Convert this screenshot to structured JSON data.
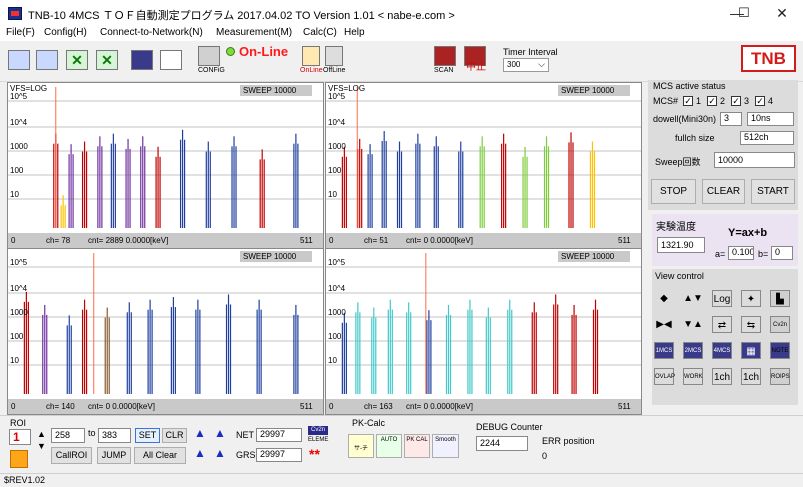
{
  "window": {
    "title": "TNB-10 4MCS ＴＯＦ自動測定プログラム 2017.04.02 TO Version 1.01 < nabe-e.com >",
    "minimize": "—",
    "maximize": "☐",
    "close": "✕"
  },
  "menu": [
    "File(F)",
    "Config(H)",
    "Connect-to-Network(N)",
    "Measurement(M)",
    "Calc(C)",
    "Help"
  ],
  "toolbar": {
    "config_label": "CONFiG",
    "online_status": "On-Line",
    "online_btn_label": "OnLine",
    "offline_btn_label": "OffLine",
    "scan_label": "SCAN",
    "stop_label": "中止",
    "timer_interval_label": "Timer Interval",
    "timer_interval_value": "300",
    "logo": "TNB"
  },
  "plots": [
    {
      "header": "VFS=LOG",
      "sweep": "SWEEP  10000",
      "ylabels": [
        "10^5",
        "10^4",
        "1000",
        "100",
        "10",
        "0"
      ],
      "footer_ch": "ch=  78",
      "footer_cnt": "cnt=   2889  0.0000[keV]",
      "footer_max": "511",
      "cursor": 78,
      "peaks": [
        {
          "ch": 78,
          "h": 0.72,
          "color": "#c00000"
        },
        {
          "ch": 90,
          "h": 0.25,
          "color": "#ffc000"
        },
        {
          "ch": 103,
          "h": 0.64,
          "color": "#7030a0"
        },
        {
          "ch": 125,
          "h": 0.66,
          "color": "#c00000"
        },
        {
          "ch": 150,
          "h": 0.7,
          "color": "#7030a0"
        },
        {
          "ch": 172,
          "h": 0.72,
          "color": "#1f3f9f"
        },
        {
          "ch": 196,
          "h": 0.68,
          "color": "#7030a0"
        },
        {
          "ch": 220,
          "h": 0.7,
          "color": "#7030a0"
        },
        {
          "ch": 245,
          "h": 0.62,
          "color": "#c00000"
        },
        {
          "ch": 285,
          "h": 0.75,
          "color": "#1f3f9f"
        },
        {
          "ch": 327,
          "h": 0.66,
          "color": "#1f3f9f"
        },
        {
          "ch": 369,
          "h": 0.7,
          "color": "#1f3f9f"
        },
        {
          "ch": 415,
          "h": 0.6,
          "color": "#c00000"
        },
        {
          "ch": 470,
          "h": 0.72,
          "color": "#1f3f9f"
        }
      ]
    },
    {
      "header": "VFS=LOG",
      "sweep": "SWEEP  10000",
      "ylabels": [
        "10^5",
        "10^4",
        "1000",
        "100",
        "10",
        "0"
      ],
      "footer_ch": "ch=  51",
      "footer_cnt": "cnt=    0  0.0000[keV]",
      "footer_max": "511",
      "cursor": 51,
      "peaks": [
        {
          "ch": 30,
          "h": 0.62,
          "color": "#c00000"
        },
        {
          "ch": 55,
          "h": 0.68,
          "color": "#c00000"
        },
        {
          "ch": 72,
          "h": 0.64,
          "color": "#1f3f9f"
        },
        {
          "ch": 95,
          "h": 0.74,
          "color": "#1f3f9f"
        },
        {
          "ch": 120,
          "h": 0.66,
          "color": "#1f3f9f"
        },
        {
          "ch": 150,
          "h": 0.72,
          "color": "#1f3f9f"
        },
        {
          "ch": 180,
          "h": 0.7,
          "color": "#1f3f9f"
        },
        {
          "ch": 220,
          "h": 0.66,
          "color": "#1f3f9f"
        },
        {
          "ch": 255,
          "h": 0.7,
          "color": "#7ccd3c"
        },
        {
          "ch": 290,
          "h": 0.72,
          "color": "#c00000"
        },
        {
          "ch": 325,
          "h": 0.62,
          "color": "#7ccd3c"
        },
        {
          "ch": 360,
          "h": 0.7,
          "color": "#7ccd3c"
        },
        {
          "ch": 400,
          "h": 0.73,
          "color": "#c00000"
        },
        {
          "ch": 435,
          "h": 0.66,
          "color": "#ffc000"
        }
      ]
    },
    {
      "header": "",
      "sweep": "SWEEP  10000",
      "ylabels": [
        "10^5",
        "10^4",
        "1000",
        "100",
        "10",
        "0"
      ],
      "footer_ch": "ch= 140",
      "footer_cnt": "cnt=    0  0.0000[keV]",
      "footer_max": "511",
      "cursor": 140,
      "peaks": [
        {
          "ch": 30,
          "h": 0.78,
          "color": "#c00000"
        },
        {
          "ch": 60,
          "h": 0.68,
          "color": "#7030a0"
        },
        {
          "ch": 100,
          "h": 0.6,
          "color": "#1f3f9f"
        },
        {
          "ch": 125,
          "h": 0.72,
          "color": "#c00000"
        },
        {
          "ch": 162,
          "h": 0.66,
          "color": "#8b5a2b"
        },
        {
          "ch": 198,
          "h": 0.7,
          "color": "#1f3f9f"
        },
        {
          "ch": 232,
          "h": 0.72,
          "color": "#1f3f9f"
        },
        {
          "ch": 270,
          "h": 0.74,
          "color": "#1f3f9f"
        },
        {
          "ch": 310,
          "h": 0.72,
          "color": "#1f3f9f"
        },
        {
          "ch": 360,
          "h": 0.76,
          "color": "#1f3f9f"
        },
        {
          "ch": 410,
          "h": 0.72,
          "color": "#1f3f9f"
        },
        {
          "ch": 470,
          "h": 0.68,
          "color": "#1f3f9f"
        }
      ]
    },
    {
      "header": "",
      "sweep": "SWEEP  10000",
      "ylabels": [
        "10^5",
        "10^4",
        "1000",
        "100",
        "10",
        "0"
      ],
      "footer_ch": "ch= 163",
      "footer_cnt": "cnt=    0  0.0000[keV]",
      "footer_max": "511",
      "cursor": 163,
      "peaks": [
        {
          "ch": 30,
          "h": 0.62,
          "color": "#1f3f9f"
        },
        {
          "ch": 52,
          "h": 0.7,
          "color": "#40c8c8"
        },
        {
          "ch": 78,
          "h": 0.66,
          "color": "#40c8c8"
        },
        {
          "ch": 105,
          "h": 0.72,
          "color": "#40c8c8"
        },
        {
          "ch": 135,
          "h": 0.7,
          "color": "#40c8c8"
        },
        {
          "ch": 168,
          "h": 0.64,
          "color": "#1f3f9f"
        },
        {
          "ch": 200,
          "h": 0.68,
          "color": "#40c8c8"
        },
        {
          "ch": 235,
          "h": 0.72,
          "color": "#40c8c8"
        },
        {
          "ch": 265,
          "h": 0.66,
          "color": "#40c8c8"
        },
        {
          "ch": 300,
          "h": 0.72,
          "color": "#40c8c8"
        },
        {
          "ch": 340,
          "h": 0.7,
          "color": "#c00000"
        },
        {
          "ch": 375,
          "h": 0.76,
          "color": "#c00000"
        },
        {
          "ch": 405,
          "h": 0.68,
          "color": "#c00000"
        },
        {
          "ch": 440,
          "h": 0.72,
          "color": "#c00000"
        }
      ]
    }
  ],
  "mcs": {
    "title": "MCS active status",
    "mcs_label": "MCS#",
    "checks": [
      {
        "num": "1",
        "checked": "✓"
      },
      {
        "num": "2",
        "checked": "✓"
      },
      {
        "num": "3",
        "checked": "✓"
      },
      {
        "num": "4",
        "checked": "✓"
      }
    ],
    "dwell_label": "dowell(Mini30n)",
    "dwell_value": "3",
    "dwell_unit": "10ns",
    "fullch_label": "fullch size",
    "fullch_value": "512ch",
    "sweep_label": "Sweep回数",
    "sweep_value": "10000",
    "stop": "STOP",
    "clear": "CLEAR",
    "start": "START"
  },
  "temp": {
    "title": "実験温度",
    "value": "1321.90",
    "formula": "Y=ax+b",
    "a_label": "a=",
    "a_value": "0.100",
    "b_label": "b=",
    "b_value": "0"
  },
  "view": {
    "title": "View control",
    "icons": [
      [
        "◆",
        "▲▼",
        "Log",
        "✦",
        "▙"
      ],
      [
        "▶◀",
        "▼▲",
        "⇄",
        "⇆",
        "Cv2n"
      ],
      [
        "1MCS",
        "2MCS",
        "4MCS",
        "▦",
        "NOTE"
      ],
      [
        "OVLAP",
        "WORK",
        "1ch",
        "1ch",
        "ROIPS"
      ]
    ]
  },
  "roi": {
    "title": "ROI",
    "number": "1",
    "from": "258",
    "to_label": "to",
    "to": "383",
    "set": "SET",
    "clr": "CLR",
    "callroi": "CallROI",
    "jump": "JUMP",
    "allclear": "All Clear",
    "net_label": "NET",
    "net_value": "29997",
    "grs_label": "GRS",
    "grs_value": "29997",
    "cv_label": "Cv2n",
    "eleme_label": "ELEME",
    "stars": "**"
  },
  "pk": {
    "title": "PK-Calc",
    "icons": [
      "サ-チ",
      "AUTO",
      "PK CAL",
      "Smooth"
    ]
  },
  "debug": {
    "title": "DEBUG Counter",
    "value": "2244",
    "err_label": "ERR position",
    "err_value": "0"
  },
  "status": "$REV1.02"
}
